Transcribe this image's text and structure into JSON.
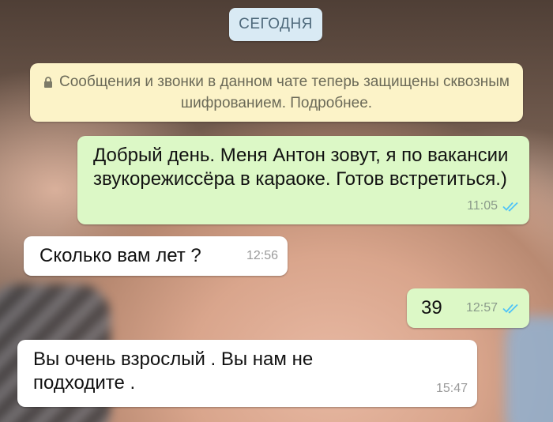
{
  "chat": {
    "date_chip": "СЕГОДНЯ",
    "system_notice": "Сообщения и звонки в данном чате теперь защищены сквозным шифрованием. Подробнее.",
    "messages": [
      {
        "direction": "outgoing",
        "text": "Добрый день. Меня Антон зовут, я по вакансии звукорежиссёра в караоке. Готов встретиться.)",
        "time": "11:05",
        "status": "read"
      },
      {
        "direction": "incoming",
        "text": "Сколько вам лет ?",
        "time": "12:56"
      },
      {
        "direction": "outgoing",
        "text": "39",
        "time": "12:57",
        "status": "read"
      },
      {
        "direction": "incoming",
        "text": "Вы очень взрослый . Вы нам не подходите .",
        "time": "15:47"
      }
    ]
  },
  "colors": {
    "outgoing_bubble": "#dcf8c6",
    "incoming_bubble": "#ffffff",
    "system_bubble": "#fcf3c8",
    "date_chip": "#d9eaf4",
    "read_ticks": "#4fc3f7"
  },
  "icons": {
    "system_notice": "lock-icon",
    "read_status": "double-check-icon"
  }
}
